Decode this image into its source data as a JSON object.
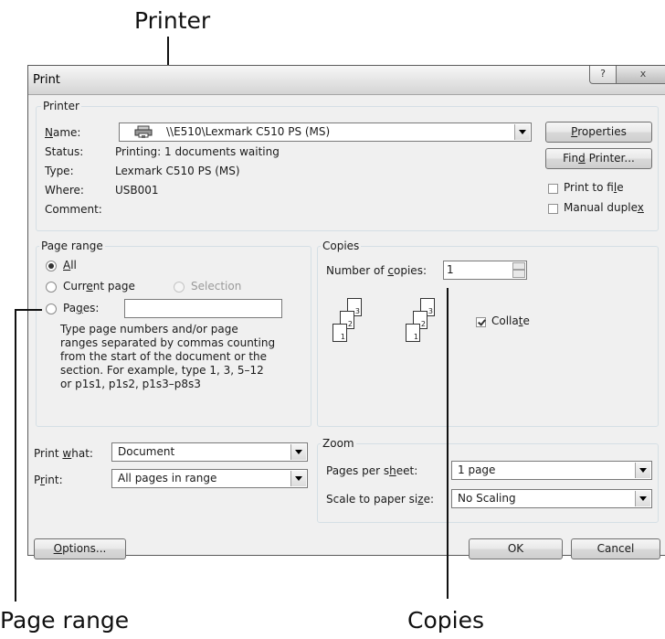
{
  "callouts": {
    "printer": "Printer",
    "page_range": "Page range",
    "copies": "Copies"
  },
  "dialog": {
    "title": "Print",
    "help_glyph": "?",
    "close_glyph": "x"
  },
  "printer_group": {
    "label": "Printer",
    "name_label_pre": "",
    "name_label_u": "N",
    "name_label_post": "ame:",
    "name_value": "\\\\E510\\Lexmark C510 PS (MS)",
    "status_label": "Status:",
    "status_value": "Printing: 1 documents waiting",
    "type_label": "Type:",
    "type_value": "Lexmark C510 PS (MS)",
    "where_label": "Where:",
    "where_value": "USB001",
    "comment_label": "Comment:",
    "properties_pre": "",
    "properties_u": "P",
    "properties_post": "roperties",
    "find_printer_pre": "Fin",
    "find_printer_u": "d",
    "find_printer_post": " Printer...",
    "print_to_file_pre": "Print to fi",
    "print_to_file_u": "l",
    "print_to_file_post": "e",
    "manual_duplex_pre": "Manual duple",
    "manual_duplex_u": "x",
    "manual_duplex_post": ""
  },
  "page_range": {
    "label": "Page range",
    "all_pre": "",
    "all_u": "A",
    "all_post": "ll",
    "current_pre": "Curr",
    "current_u": "e",
    "current_post": "nt page",
    "selection": "Selection",
    "pages_pre": "Pa",
    "pages_u": "g",
    "pages_post": "es:",
    "pages_value": "",
    "help_lines": [
      "Type page numbers and/or page",
      "ranges separated by commas counting",
      "from the start of the document or the",
      "section. For example, type 1, 3, 5–12",
      "or p1s1, p1s2, p1s3–p8s3"
    ]
  },
  "copies": {
    "label": "Copies",
    "num_pre": "Number of ",
    "num_u": "c",
    "num_post": "opies:",
    "num_value": "1",
    "collate_pre": "Colla",
    "collate_u": "t",
    "collate_post": "e",
    "page_nums": [
      "3",
      "2",
      "1"
    ]
  },
  "print_what": {
    "label_pre": "Print ",
    "label_u": "w",
    "label_post": "hat:",
    "value": "Document",
    "print_label_pre": "P",
    "print_label_u": "r",
    "print_label_post": "int:",
    "print_value": "All pages in range"
  },
  "zoom": {
    "label": "Zoom",
    "pps_pre": "Pages per s",
    "pps_u": "h",
    "pps_post": "eet:",
    "pps_value": "1 page",
    "scale_pre": "Scale to paper si",
    "scale_u": "z",
    "scale_post": "e:",
    "scale_value": "No Scaling"
  },
  "footer": {
    "options_pre": "",
    "options_u": "O",
    "options_post": "ptions...",
    "ok": "OK",
    "cancel": "Cancel"
  }
}
